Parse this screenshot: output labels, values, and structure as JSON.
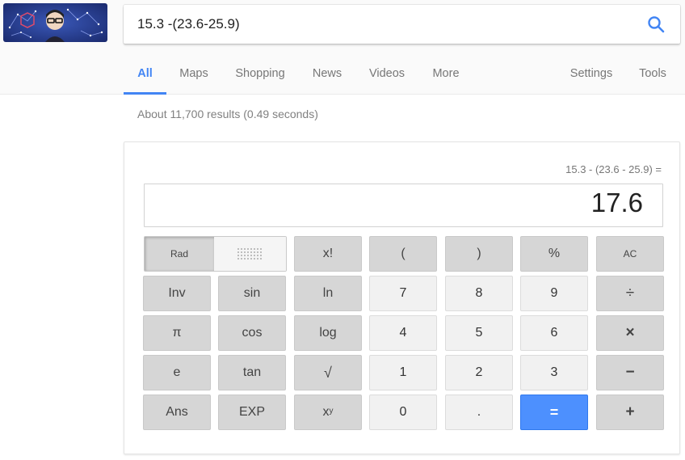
{
  "search": {
    "query": "15.3 -(23.6-25.9)"
  },
  "tabs": [
    {
      "label": "All",
      "active": true
    },
    {
      "label": "Maps"
    },
    {
      "label": "Shopping"
    },
    {
      "label": "News"
    },
    {
      "label": "Videos"
    },
    {
      "label": "More"
    },
    {
      "label": "Settings"
    },
    {
      "label": "Tools"
    }
  ],
  "result_stats": "About 11,700 results (0.49 seconds)",
  "calculator": {
    "expression": "15.3 - (23.6 - 25.9) =",
    "result": "17.6",
    "mode": {
      "rad": "Rad"
    },
    "keys": {
      "fact": "x!",
      "lparen": "(",
      "rparen": ")",
      "percent": "%",
      "ac": "AC",
      "inv": "Inv",
      "sin": "sin",
      "ln": "ln",
      "seven": "7",
      "eight": "8",
      "nine": "9",
      "divide": "÷",
      "pi": "π",
      "cos": "cos",
      "log": "log",
      "four": "4",
      "five": "5",
      "six": "6",
      "multiply": "×",
      "e": "e",
      "tan": "tan",
      "sqrt": "√",
      "one": "1",
      "two": "2",
      "three": "3",
      "minus": "−",
      "ans": "Ans",
      "exp": "EXP",
      "pow_base": "x",
      "pow_exp": "y",
      "zero": "0",
      "dot": ".",
      "equals": "=",
      "plus": "+"
    }
  },
  "colors": {
    "accent": "#4285f4",
    "equals_key": "#4d90fe",
    "dark_key": "#d6d6d6",
    "light_key": "#f1f1f1"
  }
}
